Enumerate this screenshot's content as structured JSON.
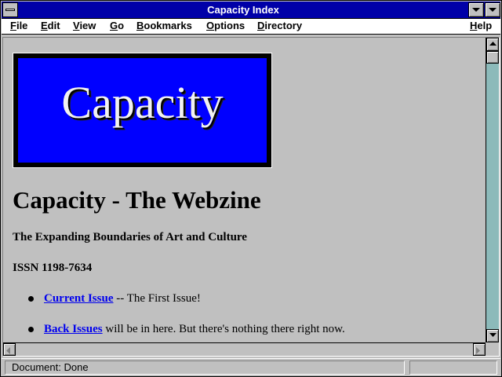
{
  "window": {
    "title": "Capacity Index"
  },
  "menu": {
    "file": "File",
    "edit": "Edit",
    "view": "View",
    "go": "Go",
    "bookmarks": "Bookmarks",
    "options": "Options",
    "directory": "Directory",
    "help": "Help"
  },
  "page": {
    "banner_text": "Capacity",
    "heading": "Capacity - The Webzine",
    "subtitle": "The Expanding Boundaries of Art and Culture",
    "issn": "ISSN 1198-7634",
    "items": [
      {
        "link": "Current Issue",
        "rest": " -- The First Issue!"
      },
      {
        "link": "Back Issues",
        "rest": " will be in here. But there's nothing there right now."
      }
    ]
  },
  "status": {
    "text": "Document: Done"
  },
  "colors": {
    "titlebar": "#0000a8",
    "banner": "#0000ff",
    "link": "#0000ee",
    "background": "#c0c0c0"
  },
  "icons": [
    "system-menu-icon",
    "minimize-icon",
    "maximize-icon",
    "scroll-up-icon",
    "scroll-down-icon",
    "scroll-left-icon",
    "scroll-right-icon",
    "bullet-icon"
  ]
}
